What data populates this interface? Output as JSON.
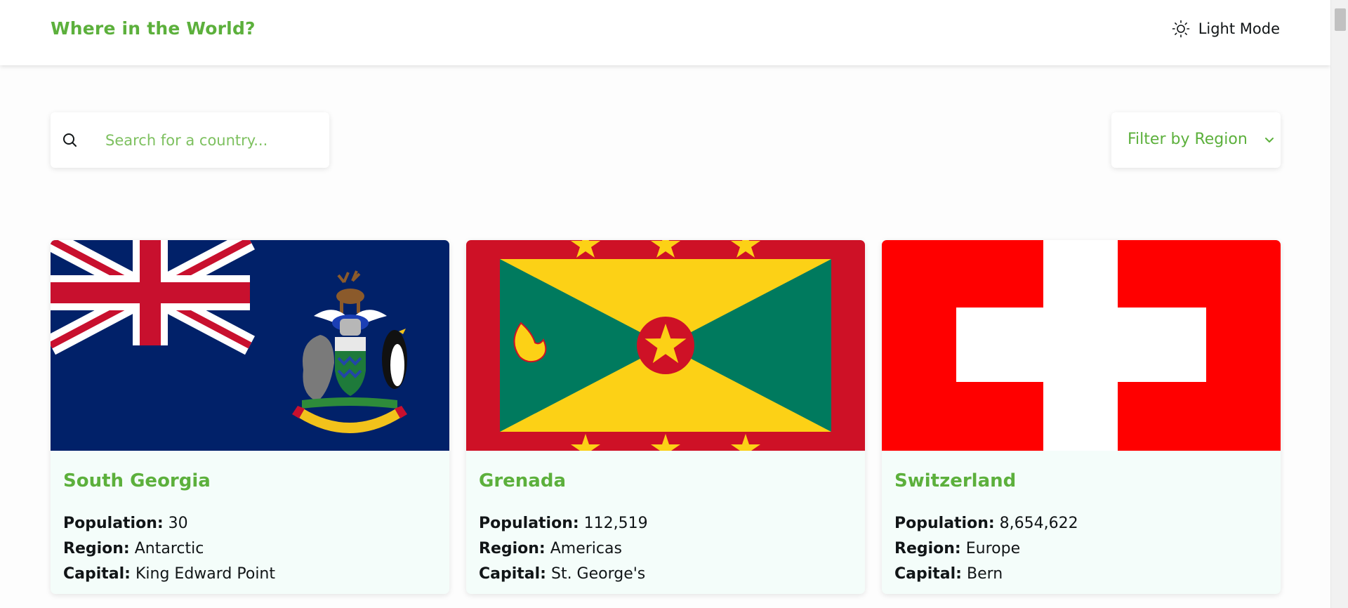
{
  "header": {
    "title": "Where in the World?",
    "mode_label": "Light Mode",
    "mode_icon": "sun-icon"
  },
  "search": {
    "placeholder": "Search for a country...",
    "value": "",
    "icon": "search-icon"
  },
  "filter": {
    "label": "Filter by Region",
    "icon": "chevron-down-icon"
  },
  "info_labels": {
    "population": "Population:",
    "region": "Region:",
    "capital": "Capital:"
  },
  "countries": [
    {
      "name": "South Georgia",
      "population": "30",
      "region": "Antarctic",
      "capital": "King Edward Point",
      "flag": "south-georgia-flag"
    },
    {
      "name": "Grenada",
      "population": "112,519",
      "region": "Americas",
      "capital": "St. George's",
      "flag": "grenada-flag"
    },
    {
      "name": "Switzerland",
      "population": "8,654,622",
      "region": "Europe",
      "capital": "Bern",
      "flag": "switzerland-flag"
    }
  ],
  "colors": {
    "accent": "#5cb03c",
    "card_background": "#f4fdfa",
    "header_background": "#ffffff",
    "text": "#111517"
  }
}
